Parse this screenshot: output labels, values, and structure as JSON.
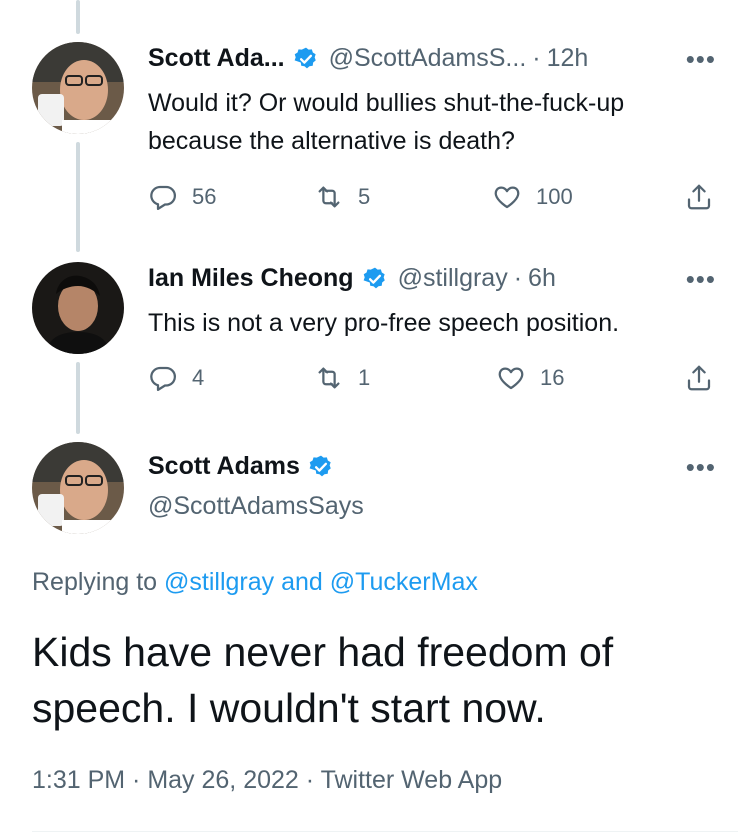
{
  "tweets": [
    {
      "display_name": "Scott Ada...",
      "handle": "@ScottAdamsS...",
      "separator": "·",
      "time": "12h",
      "text": "Would it? Or would bullies shut-the-fuck-up because the alternative is death?",
      "replies": "56",
      "retweets": "5",
      "likes": "100"
    },
    {
      "display_name": "Ian Miles Cheong",
      "handle": "@stillgray",
      "separator": "·",
      "time": "6h",
      "text": "This is not a very pro-free speech position.",
      "replies": "4",
      "retweets": "1",
      "likes": "16"
    }
  ],
  "main_tweet": {
    "display_name": "Scott Adams",
    "handle": "@ScottAdamsSays",
    "replying_prefix": "Replying to ",
    "reply_user_1": "@stillgray",
    "reply_and": " and ",
    "reply_user_2": "@TuckerMax",
    "text": "Kids have never had freedom of speech. I wouldn't start now.",
    "timestamp": "1:31 PM · May 26, 2022 · Twitter Web App"
  },
  "icons": {
    "more": "more-horizontal-icon",
    "reply": "reply-bubble-icon",
    "retweet": "retweet-icon",
    "like": "heart-icon",
    "share": "share-icon",
    "verified": "verified-badge-icon"
  },
  "colors": {
    "verified": "#1d9bf0",
    "link": "#1d9bf0",
    "muted": "#536471",
    "thread_line": "#cfd9de"
  }
}
